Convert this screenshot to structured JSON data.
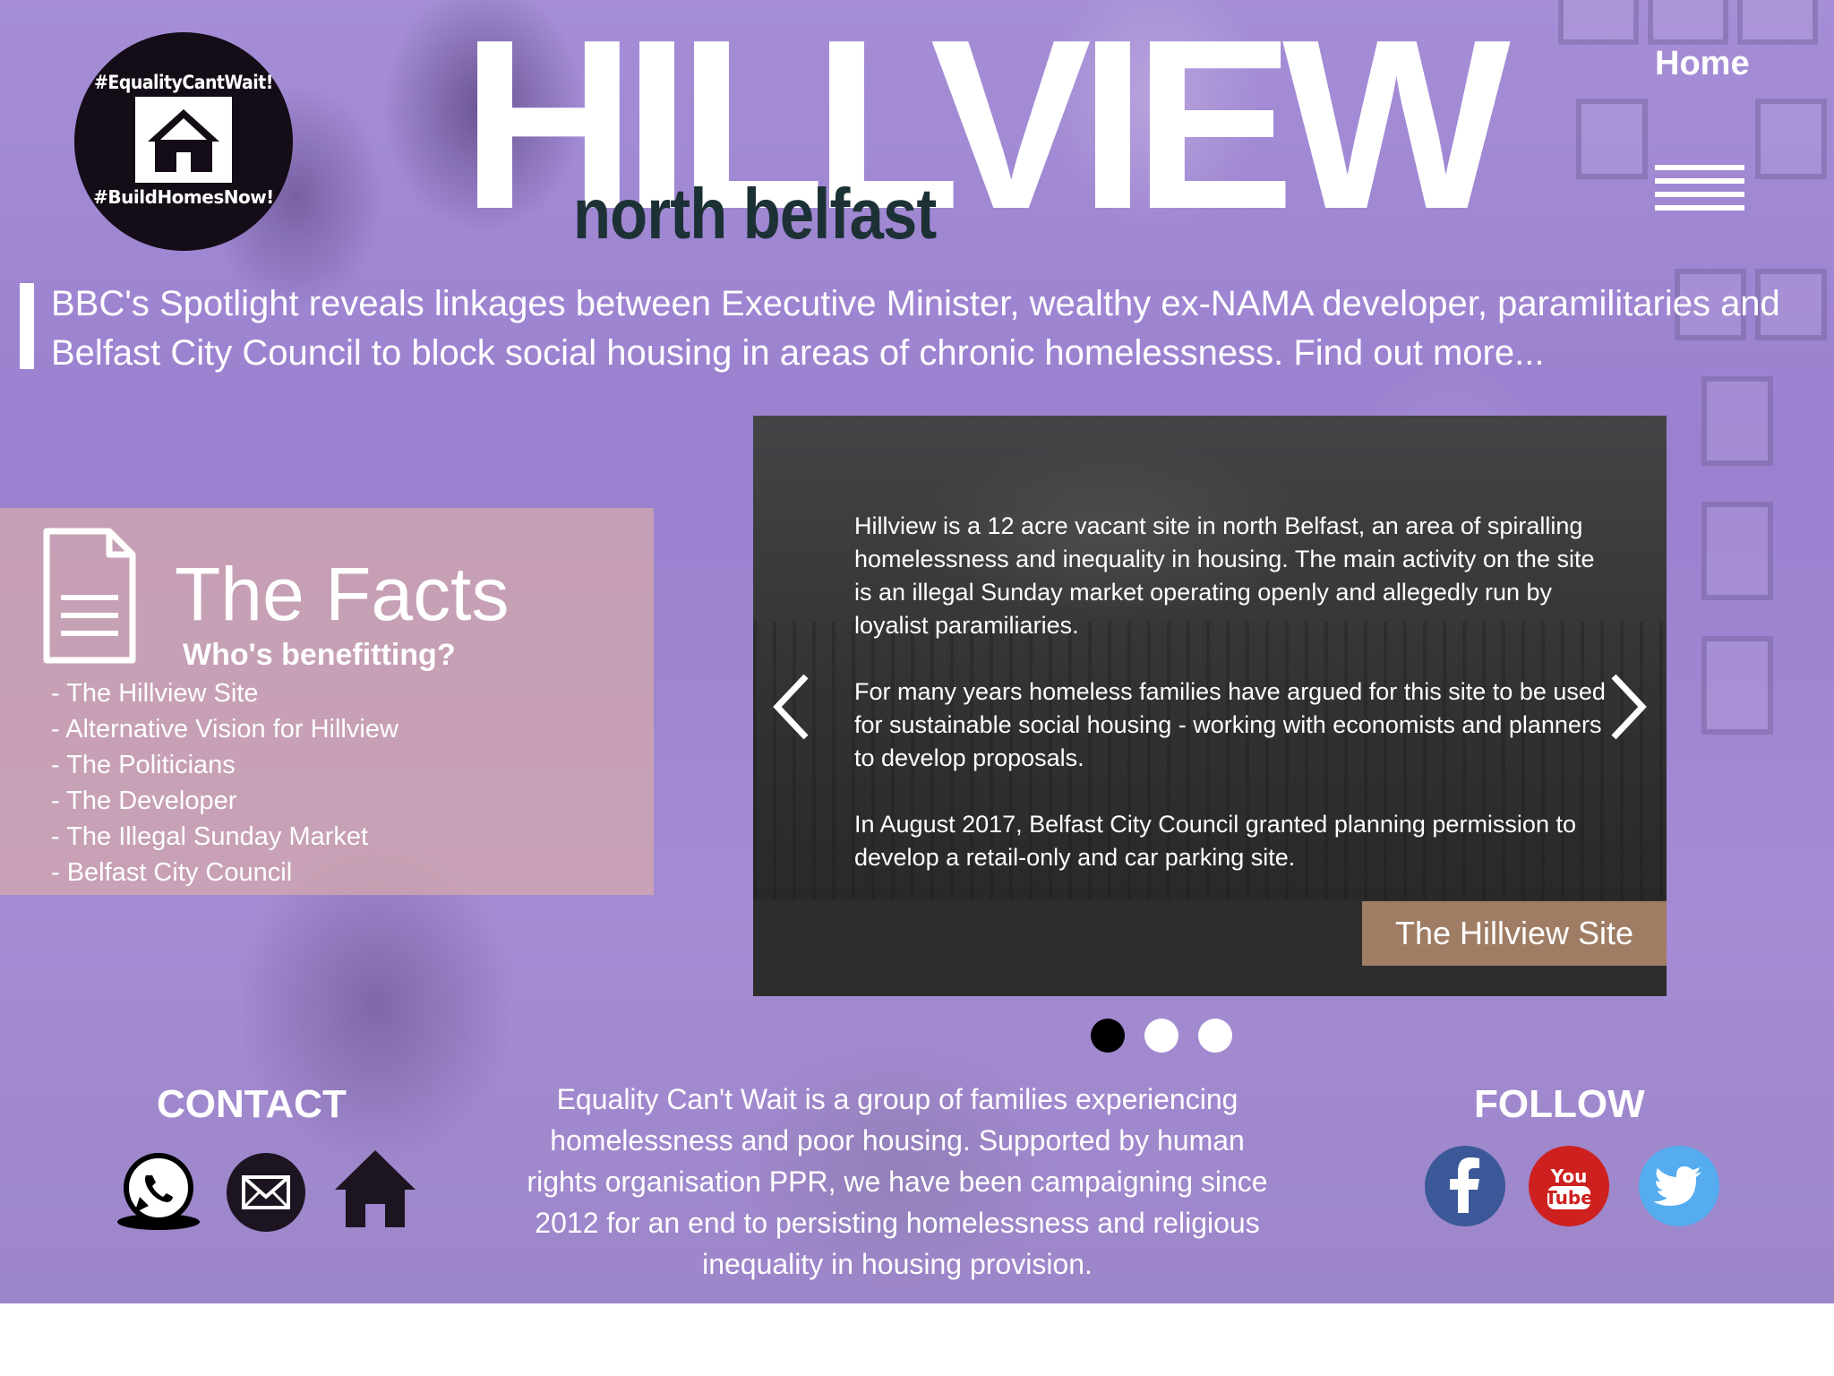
{
  "logo": {
    "tag_top": "#EqualityCantWait!",
    "tag_bottom": "#BuildHomesNow!"
  },
  "header": {
    "title": "HILLVIEW",
    "subtitle": "north belfast",
    "nav_home": "Home"
  },
  "announcement": {
    "text": "BBC's Spotlight reveals linkages between Executive Minister, wealthy ex-NAMA developer, paramilitaries and Belfast City Council to block social housing in areas of chronic homelessness. Find out more..."
  },
  "facts": {
    "title": "The Facts",
    "subtitle": "Who's benefitting?",
    "items": [
      "- The Hillview Site",
      "- Alternative Vision for Hillview",
      "- The Politicians",
      "- The Developer",
      "- The Illegal Sunday Market",
      "- Belfast City Council"
    ]
  },
  "slider": {
    "paragraphs": [
      "Hillview is a 12 acre vacant site in north Belfast, an area of spiralling homelessness and inequality in housing. The main activity on the site is an illegal Sunday market operating openly and allegedly run by loyalist paramiliaries.",
      "For many years homeless families have argued for this site to be used for sustainable social housing - working with economists and planners to develop proposals.",
      "In August 2017, Belfast City Council granted planning permission to develop a retail-only and car parking site."
    ],
    "caption": "The Hillview Site",
    "active_slide": 1,
    "slide_count": 3
  },
  "footer": {
    "contact_heading": "CONTACT",
    "follow_heading": "FOLLOW",
    "about": "Equality Can't Wait is a group of families experiencing homelessness and poor housing. Supported by human rights organisation PPR, we have been campaigning since 2012 for an end to persisting homelessness and religious inequality in housing provision.",
    "contact_icons": [
      "whatsapp-icon",
      "email-icon",
      "home-icon"
    ],
    "social_icons": [
      {
        "name": "facebook-icon",
        "color": "#3b5998"
      },
      {
        "name": "youtube-icon",
        "color": "#cd201f"
      },
      {
        "name": "twitter-icon",
        "color": "#55acee"
      }
    ]
  },
  "colors": {
    "overlay_purple": "#a58ed6",
    "facts_panel": "#d6aaaa",
    "subtitle_dark": "#1c3135"
  }
}
